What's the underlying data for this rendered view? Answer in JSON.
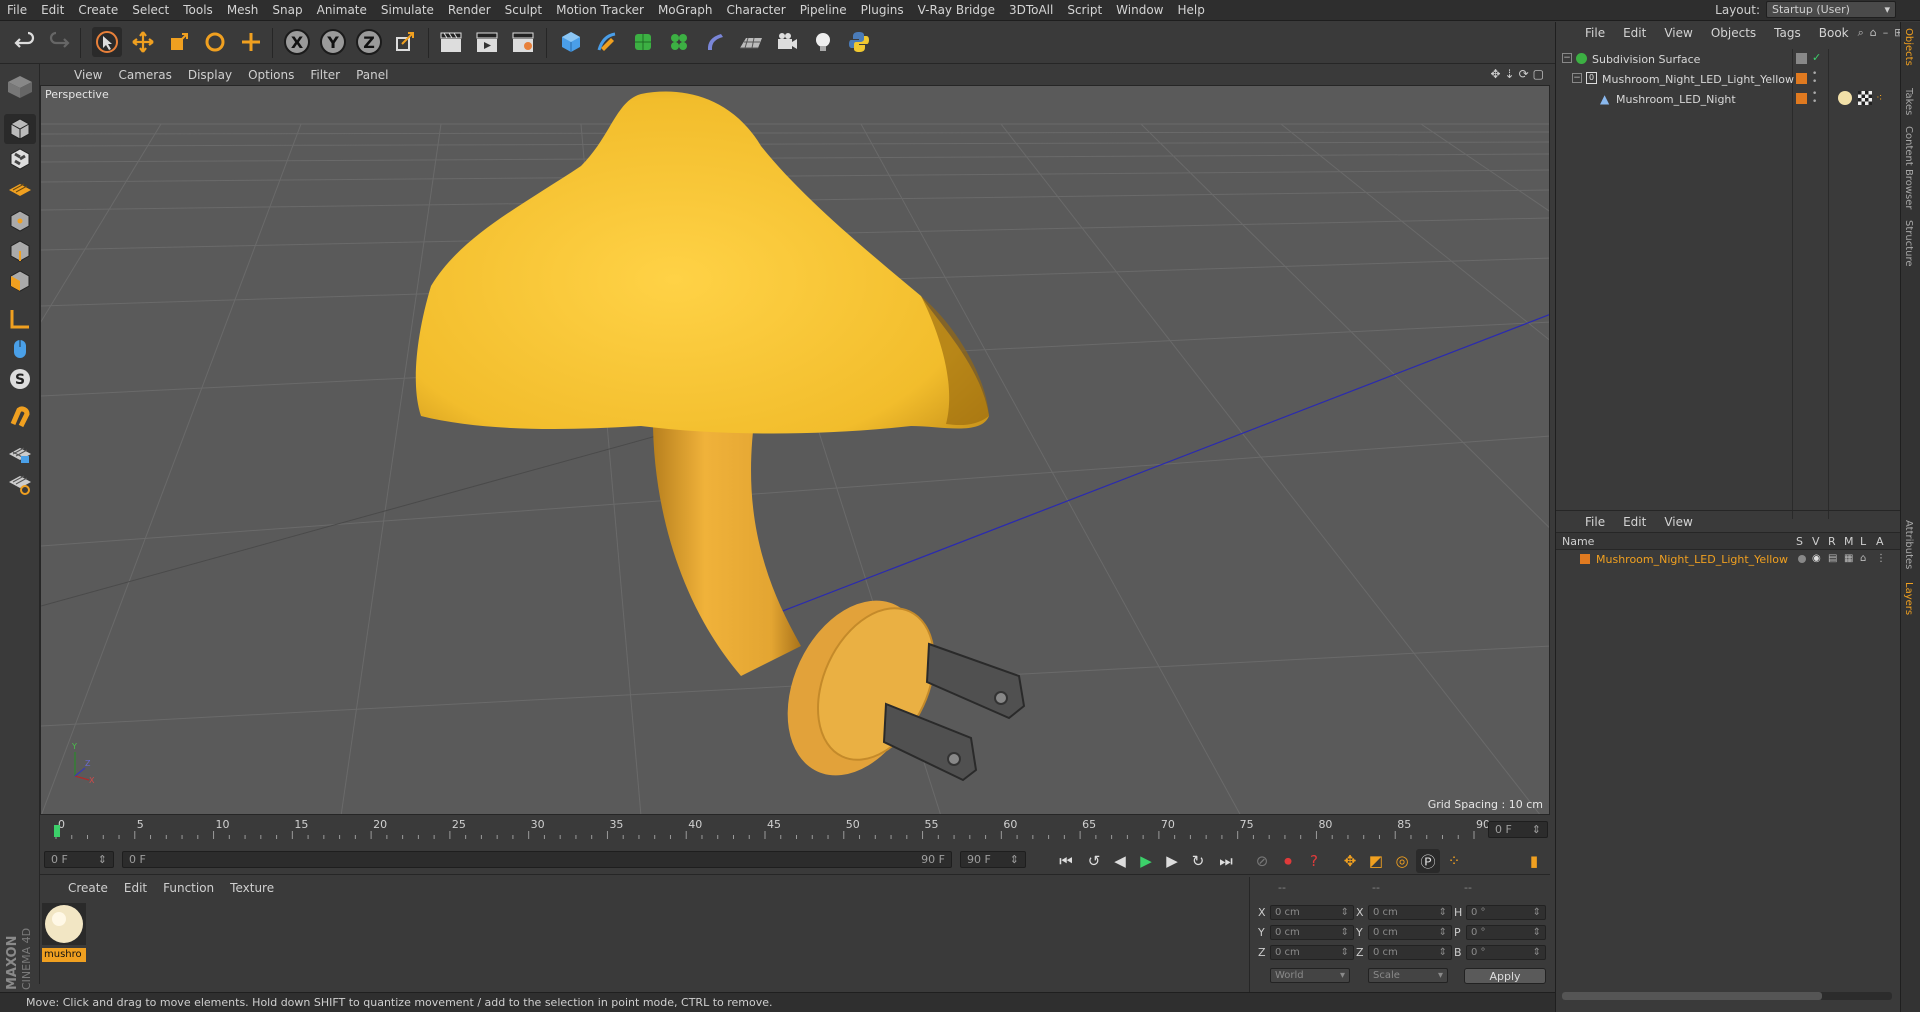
{
  "menubar": {
    "items": [
      "File",
      "Edit",
      "Create",
      "Select",
      "Tools",
      "Mesh",
      "Snap",
      "Animate",
      "Simulate",
      "Render",
      "Sculpt",
      "Motion Tracker",
      "MoGraph",
      "Character",
      "Pipeline",
      "Plugins",
      "V-Ray Bridge",
      "3DToAll",
      "Script",
      "Window",
      "Help"
    ],
    "layout_label": "Layout:",
    "layout_value": "Startup (User)"
  },
  "viewport": {
    "menu": [
      "View",
      "Cameras",
      "Display",
      "Options",
      "Filter",
      "Panel"
    ],
    "camera_label": "Perspective",
    "grid_spacing": "Grid Spacing : 10 cm",
    "colors": {
      "background": "#5a5a5a",
      "cap": "#f2c032",
      "stem": "#e8a832",
      "plug": "#4a4a4a"
    }
  },
  "timeline": {
    "ticks": [
      "0",
      "5",
      "10",
      "15",
      "20",
      "25",
      "30",
      "35",
      "40",
      "45",
      "50",
      "55",
      "60",
      "65",
      "70",
      "75",
      "80",
      "85",
      "90"
    ],
    "current_frame_field": "0 F",
    "start_field": "0 F",
    "range_start": "0 F",
    "range_end": "90 F",
    "end_field": "90 F"
  },
  "material_panel": {
    "menu": [
      "Create",
      "Edit",
      "Function",
      "Texture"
    ],
    "material_name": "mushro"
  },
  "coordinates": {
    "header_dashes": [
      "--",
      "--",
      "--"
    ],
    "rows": [
      {
        "axis": "X",
        "pos": "0 cm",
        "axis2": "X",
        "size": "0 cm",
        "axis3": "H",
        "rot": "0 °"
      },
      {
        "axis": "Y",
        "pos": "0 cm",
        "axis2": "Y",
        "size": "0 cm",
        "axis3": "P",
        "rot": "0 °"
      },
      {
        "axis": "Z",
        "pos": "0 cm",
        "axis2": "Z",
        "size": "0 cm",
        "axis3": "B",
        "rot": "0 °"
      }
    ],
    "mode_world": "World",
    "mode_scale": "Scale",
    "apply_label": "Apply"
  },
  "objects_panel": {
    "menu": [
      "File",
      "Edit",
      "View",
      "Objects",
      "Tags",
      "Book"
    ],
    "items": [
      {
        "name": "Subdivision Surface",
        "level": 0
      },
      {
        "name": "Mushroom_Night_LED_Light_Yellow",
        "level": 1
      },
      {
        "name": "Mushroom_LED_Night",
        "level": 2
      }
    ]
  },
  "layers_panel": {
    "menu": [
      "File",
      "Edit",
      "View"
    ],
    "col_name": "Name",
    "cols": [
      "S",
      "V",
      "R",
      "M",
      "L",
      "A"
    ],
    "row_name": "Mushroom_Night_LED_Light_Yellow",
    "row_color": "#e07a20"
  },
  "side_tabs": [
    "Objects",
    "Takes",
    "Content Browser",
    "Structure",
    "Attributes",
    "Layers"
  ],
  "status_text": "Move: Click and drag to move elements. Hold down SHIFT to quantize movement / add to the selection in point mode, CTRL to remove.",
  "brand": {
    "line1": "MAXON",
    "line2": "CINEMA 4D"
  }
}
